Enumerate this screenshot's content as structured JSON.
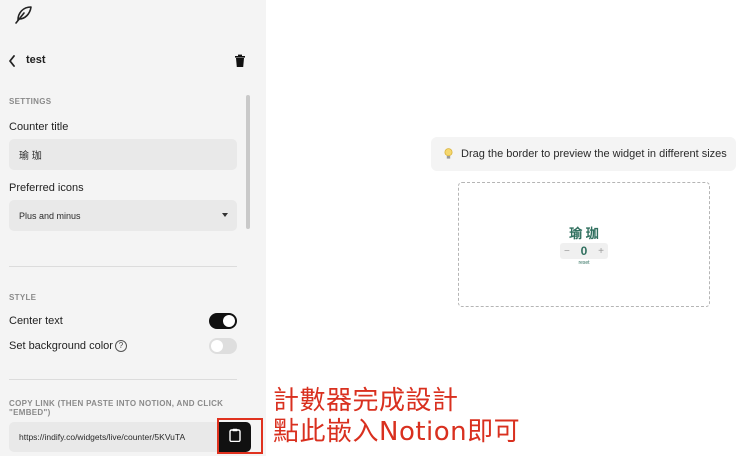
{
  "header": {
    "page_name": "test"
  },
  "settings": {
    "section_label": "SETTINGS",
    "counter_title_label": "Counter title",
    "counter_title_value": "瑜 珈",
    "preferred_icons_label": "Preferred icons",
    "preferred_icons_value": "Plus and minus"
  },
  "style": {
    "section_label": "STYLE",
    "center_text_label": "Center text",
    "center_text_on": true,
    "background_color_label": "Set background color",
    "background_color_on": false
  },
  "copy_link": {
    "section_label": "COPY LINK (THEN PASTE INTO NOTION, AND CLICK \"EMBED\")",
    "url": "https://indify.co/widgets/live/counter/5KVuTA"
  },
  "preview": {
    "hint": "Drag the border to preview the widget in different sizes",
    "widget_title": "瑜 珈",
    "count": "0",
    "minus": "−",
    "plus": "+",
    "reset_label": "reset"
  },
  "annotation": {
    "line1": "計數器完成設計",
    "line2": "點此嵌入Notion即可"
  },
  "colors": {
    "accent": "#2f6f5e",
    "annotation": "#d9301f",
    "toggle_on": "#111111"
  },
  "icons": [
    "feather-logo-icon",
    "chevron-left-icon",
    "trash-icon",
    "chevron-down-icon",
    "help-circle-icon",
    "clipboard-icon",
    "lightbulb-icon"
  ]
}
